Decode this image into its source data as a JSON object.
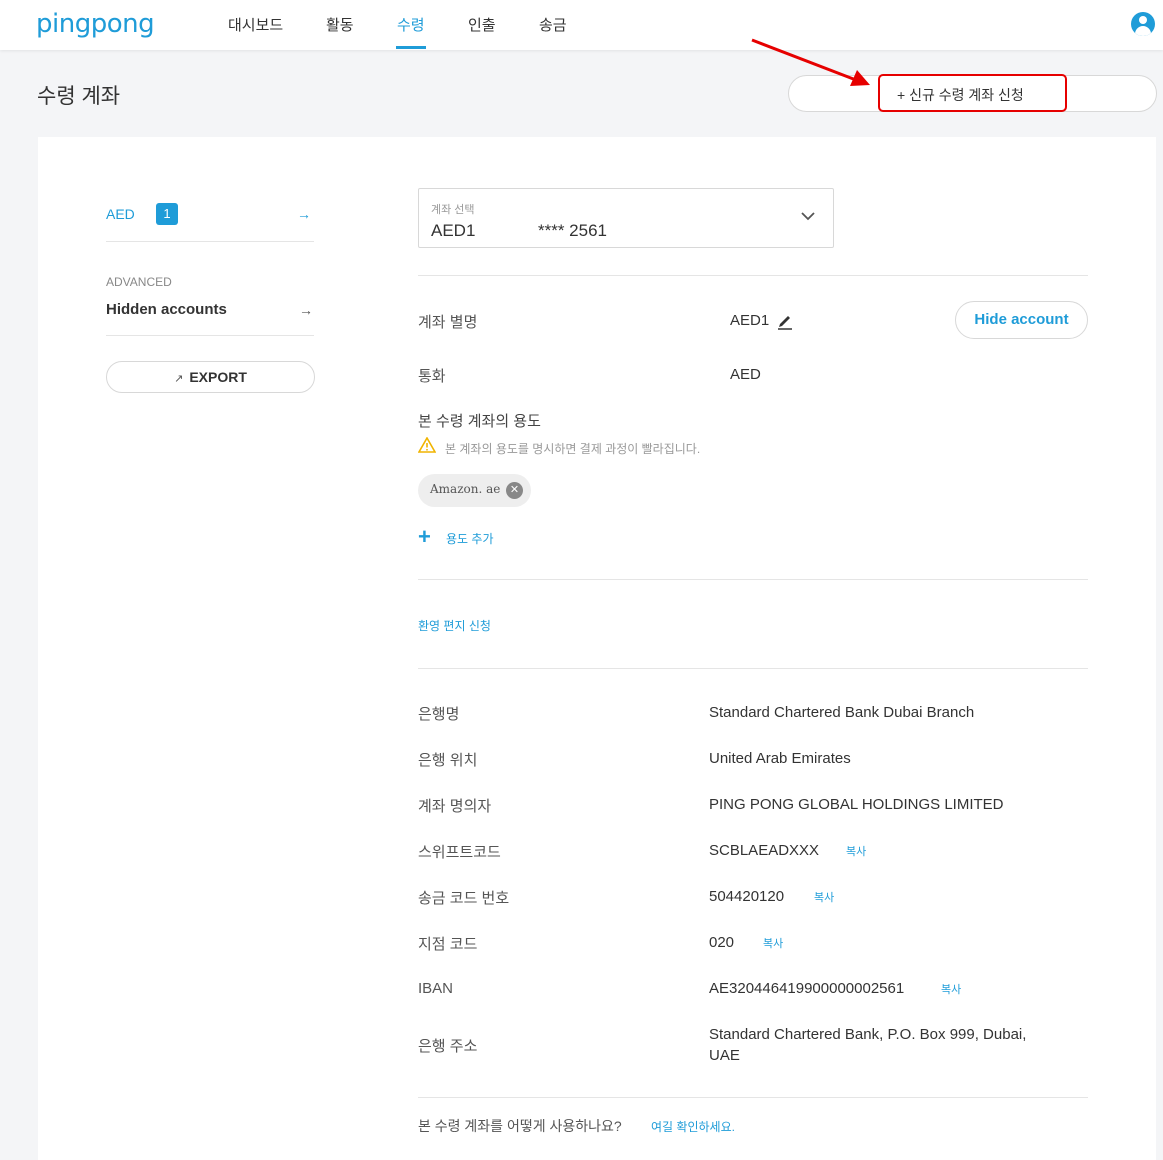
{
  "app": {
    "logo": "pingpong"
  },
  "nav": [
    {
      "label": "대시보드"
    },
    {
      "label": "활동"
    },
    {
      "label": "수령"
    },
    {
      "label": "인출"
    },
    {
      "label": "송금"
    }
  ],
  "page": {
    "title": "수령 계좌",
    "new_account_label": "+  신규 수령 계좌 신청"
  },
  "sidebar": {
    "currency": "AED",
    "currency_count": "1",
    "advanced_label": "ADVANCED",
    "hidden_accounts": "Hidden accounts",
    "export_label": "EXPORT"
  },
  "account_select": {
    "caption": "계좌 선택",
    "name": "AED1",
    "number": "**** 2561"
  },
  "details": {
    "alias_label": "계좌 별명",
    "alias_value": "AED1",
    "hide_button": "Hide account",
    "currency_label": "통화",
    "currency_value": "AED",
    "usage_title": "본 수령 계좌의 용도",
    "usage_warning": "본 계좌의 용도를 명시하면 결제 과정이 빨라집니다.",
    "usage_tag": "Amazon. ae",
    "add_usage": "용도 추가",
    "fx_link": "환영 편지 신청"
  },
  "bank_info": [
    {
      "label": "은행명",
      "value": "Standard Chartered Bank Dubai Branch",
      "copy": ""
    },
    {
      "label": "은행 위치",
      "value": "United Arab Emirates",
      "copy": ""
    },
    {
      "label": "계좌 명의자",
      "value": "PING PONG GLOBAL HOLDINGS LIMITED",
      "copy": ""
    },
    {
      "label": "스위프트코드",
      "value": "SCBLAEADXXX",
      "copy": "복사"
    },
    {
      "label": "송금 코드 번호",
      "value": "504420120",
      "copy": "복사"
    },
    {
      "label": "지점 코드",
      "value": "020",
      "copy": "복사"
    },
    {
      "label": "IBAN",
      "value": "AE320446419900000002561",
      "copy": "복사"
    },
    {
      "label": "은행 주소",
      "value_line1": "Standard Chartered Bank, P.O. Box 999, Dubai,",
      "value_line2": "UAE",
      "copy": ""
    }
  ],
  "footer": {
    "question": "본 수령 계좌를 어떻게 사용하나요?",
    "link": "여길 확인하세요."
  },
  "colors": {
    "accent": "#1f9cd8",
    "annotation": "#e60000"
  },
  "icons": [
    "user-avatar-icon",
    "arrow-right-icon",
    "external-link-icon",
    "chevron-down-icon",
    "pencil-icon",
    "warning-icon",
    "close-circle-icon",
    "plus-icon",
    "annotation-arrow"
  ]
}
